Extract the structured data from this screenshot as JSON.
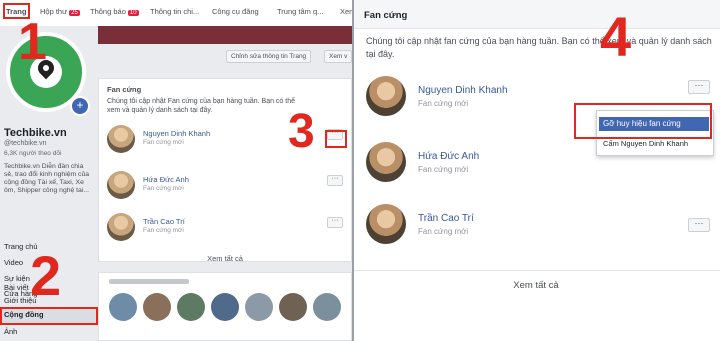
{
  "left": {
    "tabs": [
      {
        "label": "Trang"
      },
      {
        "label": "Hộp thư",
        "count": "25"
      },
      {
        "label": "Thông báo",
        "count": "10"
      },
      {
        "label": "Thông tin chi..."
      },
      {
        "label": "Công cụ đăng"
      },
      {
        "label": "Trung tâm q..."
      },
      {
        "label": "Xem"
      }
    ],
    "page": {
      "name": "Techbike.vn",
      "handle": "@techbike.vn",
      "followers": "6,3K người theo dõi",
      "description": "Techbike.vn Diễn đàn chia sẻ, trao đổi kinh nghiệm của cộng đồng Tài xế, Taxi, Xe ôm, Shipper công nghệ tai..."
    },
    "nav": [
      "Trang chủ",
      "Video",
      "Sự kiện",
      "Cửa hàng",
      "Bài viết",
      "Giới thiệu",
      "Cộng đồng",
      "Ảnh"
    ],
    "cover_buttons": [
      "Chỉnh sửa thông tin Trang",
      "Xem v"
    ],
    "fan_card": {
      "title": "Fan cứng",
      "description": "Chúng tôi cập nhật Fan cứng của bạn hàng tuần. Bạn có thể xem và quản lý danh sách tại đây.",
      "fans": [
        {
          "name": "Nguyen Dinh Khanh",
          "sub": "Fan cứng mới",
          "more": "···"
        },
        {
          "name": "Hứa Đức Anh",
          "sub": "Fan cứng mới",
          "more": "···"
        },
        {
          "name": "Trần Cao Trí",
          "sub": "Fan cứng mới",
          "more": "···"
        }
      ],
      "see_all": "Xem tất cả"
    }
  },
  "right": {
    "title": "Fan cứng",
    "description": "Chúng tôi cập nhật fan cứng của bạn hàng tuần. Bạn có thể xem và quản lý danh sách tại đây.",
    "fans": [
      {
        "name": "Nguyen Dinh Khanh",
        "sub": "Fan cứng mới",
        "more": "···"
      },
      {
        "name": "Hứa Đức Anh",
        "sub": "Fan cứng mới",
        "more": "···"
      },
      {
        "name": "Trần Cao Trí",
        "sub": "Fan cứng mới",
        "more": "···"
      }
    ],
    "menu": [
      "Gỡ huy hiệu fan cứng",
      "Cấm Nguyen Dinh Khanh"
    ],
    "see_all": "Xem tất cả"
  },
  "annotations": [
    "1",
    "2",
    "3",
    "4"
  ],
  "colors": {
    "link": "#385898",
    "highlight": "#4267b2",
    "annotation": "#e0281e",
    "cover": "#7a2e37"
  }
}
